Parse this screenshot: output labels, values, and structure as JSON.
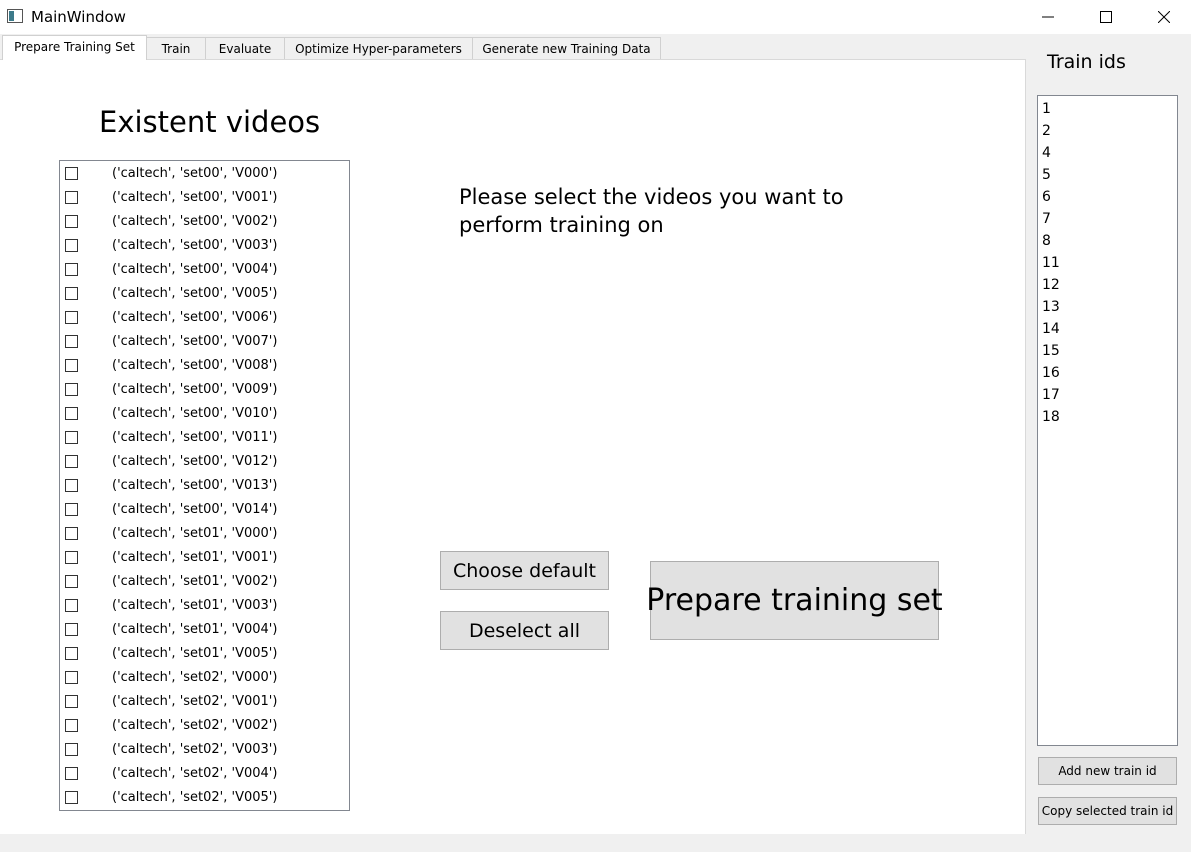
{
  "window": {
    "title": "MainWindow"
  },
  "tabs": [
    {
      "label": "Prepare Training Set",
      "active": true
    },
    {
      "label": "Train",
      "active": false
    },
    {
      "label": "Evaluate",
      "active": false
    },
    {
      "label": "Optimize Hyper-parameters",
      "active": false
    },
    {
      "label": "Generate new Training Data",
      "active": false
    }
  ],
  "prepare": {
    "heading": "Existent videos",
    "instruction": "Please select the videos you want to perform training on",
    "videos": [
      "('caltech', 'set00', 'V000')",
      "('caltech', 'set00', 'V001')",
      "('caltech', 'set00', 'V002')",
      "('caltech', 'set00', 'V003')",
      "('caltech', 'set00', 'V004')",
      "('caltech', 'set00', 'V005')",
      "('caltech', 'set00', 'V006')",
      "('caltech', 'set00', 'V007')",
      "('caltech', 'set00', 'V008')",
      "('caltech', 'set00', 'V009')",
      "('caltech', 'set00', 'V010')",
      "('caltech', 'set00', 'V011')",
      "('caltech', 'set00', 'V012')",
      "('caltech', 'set00', 'V013')",
      "('caltech', 'set00', 'V014')",
      "('caltech', 'set01', 'V000')",
      "('caltech', 'set01', 'V001')",
      "('caltech', 'set01', 'V002')",
      "('caltech', 'set01', 'V003')",
      "('caltech', 'set01', 'V004')",
      "('caltech', 'set01', 'V005')",
      "('caltech', 'set02', 'V000')",
      "('caltech', 'set02', 'V001')",
      "('caltech', 'set02', 'V002')",
      "('caltech', 'set02', 'V003')",
      "('caltech', 'set02', 'V004')",
      "('caltech', 'set02', 'V005')"
    ],
    "choose_default_label": "Choose default",
    "deselect_all_label": "Deselect all",
    "prepare_label": "Prepare training set"
  },
  "train_panel": {
    "heading": "Train ids",
    "ids": [
      "1",
      "2",
      "4",
      "5",
      "6",
      "7",
      "8",
      "11",
      "12",
      "13",
      "14",
      "15",
      "16",
      "17",
      "18"
    ],
    "add_label": "Add new train id",
    "copy_label": "Copy selected train id"
  }
}
